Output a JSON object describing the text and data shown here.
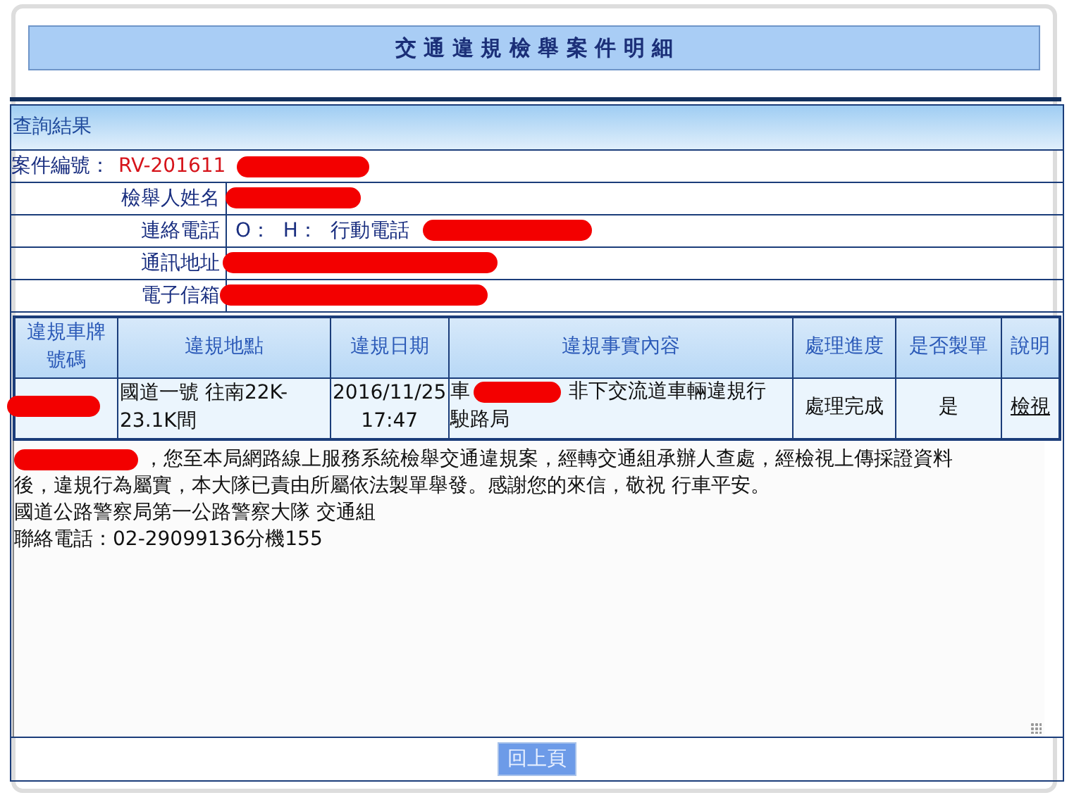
{
  "page_title": "交 通 違 規 檢 舉 案 件 明 細",
  "result": {
    "heading": "查詢結果",
    "case_no": {
      "label": "案件編號：",
      "value": "RV-201611"
    },
    "fields": [
      {
        "label": "檢舉人姓名"
      },
      {
        "label": "連絡電話",
        "value": "O：  H：  行動電話"
      },
      {
        "label": "通訊地址"
      },
      {
        "label": "電子信箱"
      }
    ]
  },
  "violations": {
    "columns": [
      "違規車牌號碼",
      "違規地點",
      "違規日期",
      "違規事實內容",
      "處理進度",
      "是否製單",
      "說明"
    ],
    "rows": [
      {
        "location": "國道一號 往南22K-23.1K間",
        "date": "2016/11/25 17:47",
        "content_start": "車",
        "content_mid": "非下交流道車輛違規行",
        "content_end": "駛路局",
        "progress": "處理完成",
        "ticketed": "是",
        "link": "檢視"
      }
    ]
  },
  "message": [
    "，您至本局網路線上服務系統檢舉交通違規案，經轉交通組承辦人查處，經檢視上傳採證資料",
    "後，違規行為屬實，本大隊已責由所屬依法製單舉發。感謝您的來信，敬祝 行車平安。",
    "國道公路警察局第一公路警察大隊 交通組",
    "聯絡電話：02-29099136分機155"
  ],
  "back_button": "回上頁"
}
